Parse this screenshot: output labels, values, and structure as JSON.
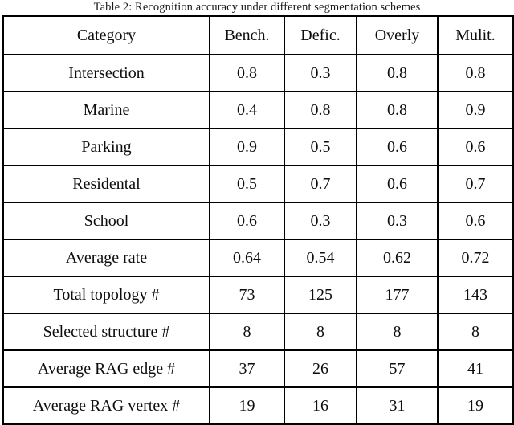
{
  "caption": "Table 2: Recognition accuracy under different segmentation schemes",
  "table": {
    "columns": [
      "Category",
      "Bench.",
      "Defic.",
      "Overly",
      "Mulit."
    ],
    "rows": [
      {
        "label": "Intersection",
        "values": [
          "0.8",
          "0.3",
          "0.8",
          "0.8"
        ]
      },
      {
        "label": "Marine",
        "values": [
          "0.4",
          "0.8",
          "0.8",
          "0.9"
        ]
      },
      {
        "label": "Parking",
        "values": [
          "0.9",
          "0.5",
          "0.6",
          "0.6"
        ]
      },
      {
        "label": "Residental",
        "values": [
          "0.5",
          "0.7",
          "0.6",
          "0.7"
        ]
      },
      {
        "label": "School",
        "values": [
          "0.6",
          "0.3",
          "0.3",
          "0.6"
        ]
      },
      {
        "label": "Average rate",
        "values": [
          "0.64",
          "0.54",
          "0.62",
          "0.72"
        ]
      },
      {
        "label": "Total topology #",
        "values": [
          "73",
          "125",
          "177",
          "143"
        ]
      },
      {
        "label": "Selected structure #",
        "values": [
          "8",
          "8",
          "8",
          "8"
        ]
      },
      {
        "label": "Average RAG edge #",
        "values": [
          "37",
          "26",
          "57",
          "41"
        ]
      },
      {
        "label": "Average RAG vertex #",
        "values": [
          "19",
          "16",
          "31",
          "19"
        ]
      }
    ]
  },
  "style": {
    "border_color": "#000000",
    "text_color": "#0d0d0d",
    "background": "#ffffff"
  }
}
